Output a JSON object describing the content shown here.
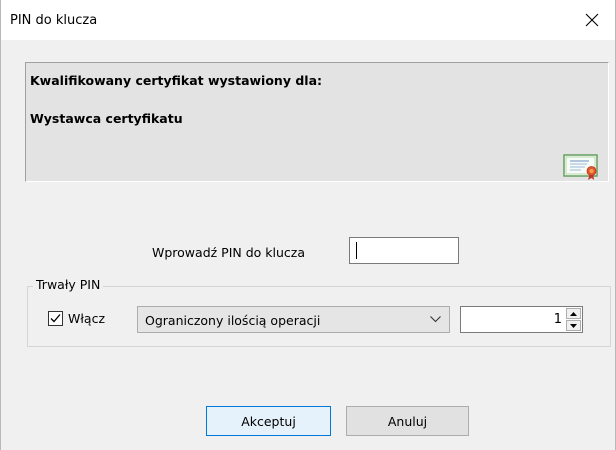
{
  "window": {
    "title": "PIN do klucza"
  },
  "certificate_panel": {
    "line1": "Kwalifikowany certyfikat wystawiony dla:",
    "line2": "Wystawca certyfikatu",
    "icon": "certificate-icon"
  },
  "pin": {
    "label": "Wprowadź PIN do klucza",
    "value": ""
  },
  "persistent_pin": {
    "legend": "Trwały PIN",
    "enable_label": "Włącz",
    "enable_checked": true,
    "mode_selected": "Ograniczony ilością operacji",
    "count_value": "1"
  },
  "buttons": {
    "accept": "Akceptuj",
    "cancel": "Anuluj"
  },
  "colors": {
    "accent": "#0078d7",
    "dialog_bg": "#f0f0f0",
    "panel_bg": "#e3e3e3"
  }
}
